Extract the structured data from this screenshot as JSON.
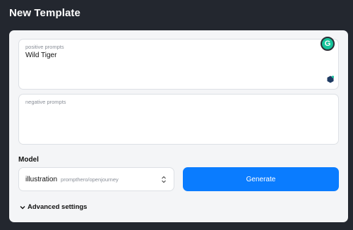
{
  "header": {
    "title": "New Template"
  },
  "prompts": {
    "positive": {
      "placeholder": "positive prompts",
      "value": "Wild Tiger"
    },
    "negative": {
      "placeholder": "negative prompts",
      "value": ""
    }
  },
  "extension": {
    "grammarly_letter": "G"
  },
  "model": {
    "label": "Model",
    "selected": "illustration",
    "selected_detail": "prompthero/openjourney"
  },
  "actions": {
    "generate_label": "Generate"
  },
  "advanced": {
    "label": "Advanced settings"
  },
  "colors": {
    "accent": "#0a7cff",
    "background": "#23272f",
    "panel": "#f4f5f7",
    "grammarly": "#15c39a"
  }
}
